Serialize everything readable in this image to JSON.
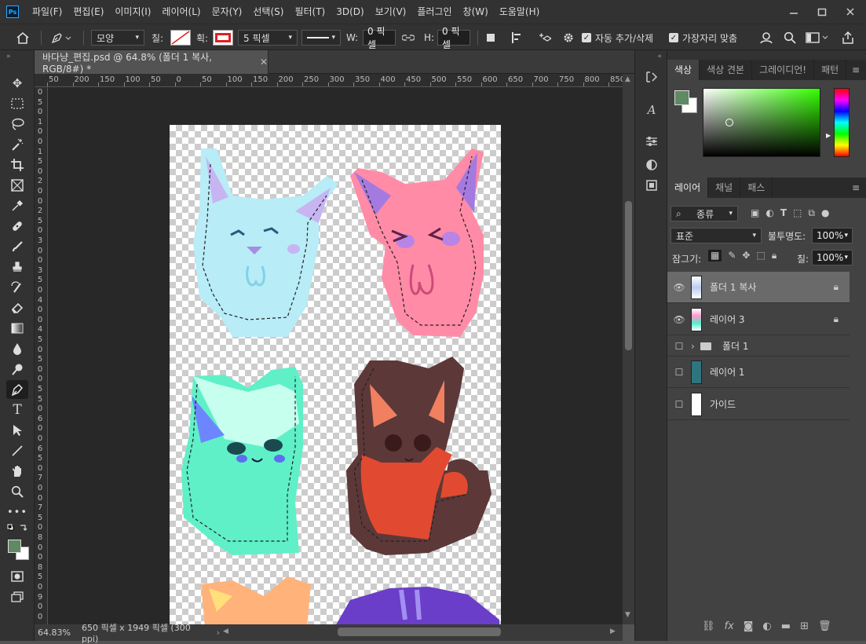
{
  "app": {
    "logo": "Ps"
  },
  "menu": [
    "파일(F)",
    "편집(E)",
    "이미지(I)",
    "레이어(L)",
    "문자(Y)",
    "선택(S)",
    "필터(T)",
    "3D(D)",
    "보기(V)",
    "플러그인",
    "창(W)",
    "도움말(H)"
  ],
  "options": {
    "shape_mode": "모양",
    "fill_label": "칠:",
    "stroke_label": "획:",
    "stroke_size": "5 픽셀",
    "width_label": "W:",
    "width_value": "0 픽셀",
    "height_label": "H:",
    "height_value": "0 픽셀",
    "auto_add_delete": "자동 추가/삭제",
    "align_edges": "가장자리 맞춤"
  },
  "document": {
    "tab_title": "바다냥_편집.psd @ 64.8% (폴더 1 복사, RGB/8#) *",
    "zoom": "64.83%",
    "doc_info": "650 픽셀 x 1949 픽셀 (300 ppi)"
  },
  "ruler": {
    "h_labels": [
      "50",
      "200",
      "150",
      "100",
      "50",
      "0",
      "50",
      "100",
      "150",
      "200",
      "250",
      "300",
      "350",
      "400",
      "450",
      "500",
      "550",
      "600",
      "650",
      "700",
      "750",
      "800",
      "850"
    ],
    "v_labels": [
      "0",
      "5",
      "0",
      "1",
      "0",
      "0",
      "1",
      "5",
      "0",
      "2",
      "0",
      "0",
      "2",
      "5",
      "0",
      "3",
      "0",
      "0",
      "3",
      "5",
      "0",
      "4",
      "0",
      "0",
      "4",
      "5",
      "0",
      "5",
      "0",
      "0",
      "5",
      "5",
      "0",
      "6",
      "0",
      "0",
      "6",
      "5",
      "0",
      "7",
      "0",
      "0",
      "7",
      "5",
      "0",
      "8",
      "0",
      "0",
      "8",
      "5",
      "0",
      "9",
      "0",
      "0"
    ]
  },
  "color_panel": {
    "tabs": [
      "색상",
      "색상 견본",
      "그레이디언!",
      "패턴"
    ],
    "fg_color": "#5f8a63",
    "bg_color": "#ffffff",
    "hue_color": "#33ff00"
  },
  "layers_panel": {
    "tabs": [
      "레이어",
      "채널",
      "패스"
    ],
    "filter_kind": "종류",
    "blend_mode": "표준",
    "opacity_label": "불투명도:",
    "opacity_value": "100%",
    "lock_label": "잠그기:",
    "fill_label": "칠:",
    "fill_value": "100%",
    "layers": [
      {
        "name": "폴더 1 복사",
        "visible": true,
        "locked": true,
        "selected": true
      },
      {
        "name": "레이어 3",
        "visible": true,
        "locked": true,
        "selected": false
      },
      {
        "name": "폴더 1",
        "visible": false,
        "locked": false,
        "selected": false,
        "group": true
      },
      {
        "name": "레이어 1",
        "visible": false,
        "locked": false,
        "selected": false
      },
      {
        "name": "가이드",
        "visible": false,
        "locked": false,
        "selected": false
      }
    ]
  }
}
